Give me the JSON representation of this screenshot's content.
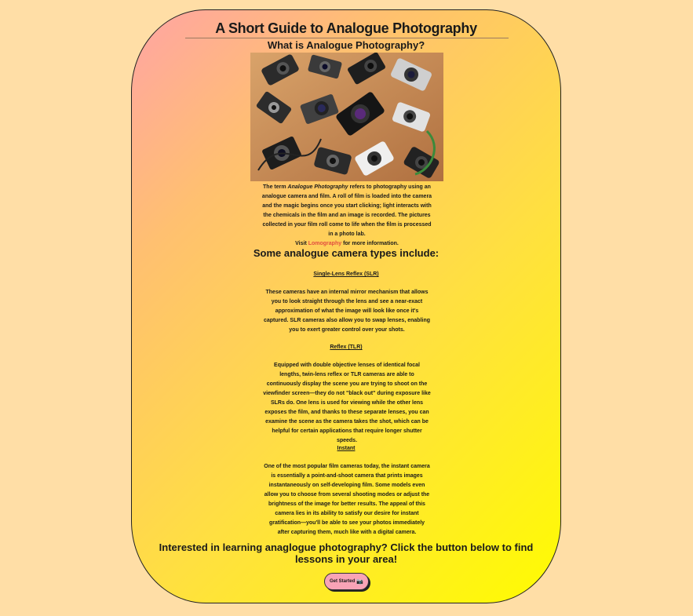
{
  "header": {
    "title": "A Short Guide to Analogue Photography",
    "subtitle": "What is Analogue Photography?"
  },
  "intro": {
    "text_before": "The term ",
    "term": "Analogue Photography",
    "text_after": " refers to photography using an analogue camera and film. A roll of film is loaded into the camera and the magic begins once you start clicking; light interacts with the chemicals in the film and an image is recorded. The pictures collected in your film roll come to life when the film is processed in a photo lab.",
    "visit_prefix": "Visit ",
    "link_text": "Lomography",
    "visit_suffix": " for more information."
  },
  "types": {
    "heading": "Some analogue camera types include:",
    "items": [
      {
        "title": "Single-Lens Reflex (SLR)",
        "description": "These cameras have an internal mirror mechanism that allows you to look straight through the lens and see a near-exact approximation of what the image will look like once it's captured. SLR cameras also allow you to swap lenses, enabling you to exert greater control over your shots."
      },
      {
        "title": "Reflex (TLR)",
        "description": "Equipped with double objective lenses of identical focal lengths, twin-lens reflex or TLR cameras are able to continuously display the scene you are trying to shoot on the viewfinder screen—they do not \"black out\" during exposure like SLRs do. One lens is used for viewing while the other lens exposes the film, and thanks to these separate lenses, you can examine the scene as the camera takes the shot, which can be helpful for certain applications that require longer shutter speeds."
      },
      {
        "title": "Instant",
        "description": "One of the most popular film cameras today, the instant camera is essentially a point-and-shoot camera that prints images instantaneously on self-developing film. Some models even allow you to choose from several shooting modes or adjust the brightness of the image for better results. The appeal of this camera lies in its ability to satisfy our desire for instant gratification—you'll be able to see your photos immediately after capturing them, much like with a digital camera."
      }
    ]
  },
  "cta": {
    "text": "Interested in learning anaglogue photography? Click the button below to find lessons in your area!",
    "button_label": "Get Started",
    "button_icon": "camera-icon",
    "button_glyph": "📷"
  },
  "colors": {
    "background": "#ffdea6",
    "gradient_start": "#ffa4a4",
    "gradient_end": "#fffc00",
    "link": "#e24d3f",
    "button": "#f9a3b6"
  }
}
